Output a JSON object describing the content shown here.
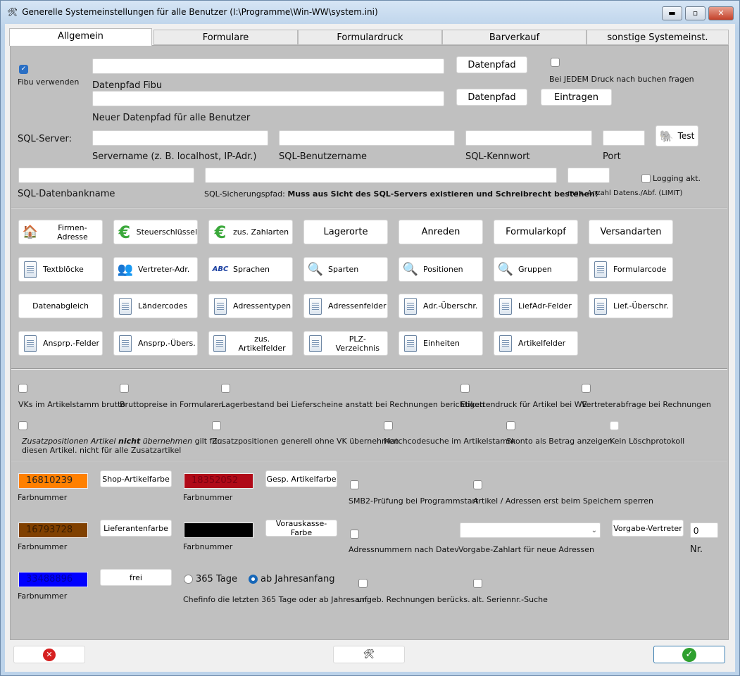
{
  "window": {
    "title": "Generelle Systemeinstellungen für alle Benutzer (I:\\Programme\\Win-WW\\system.ini)",
    "minimize": "▬",
    "maximize": "▫",
    "close": "✕"
  },
  "tabs": [
    "Allgemein",
    "Formulare",
    "Formulardruck",
    "Barverkauf",
    "sonstige Systemeinst."
  ],
  "fibu": {
    "use_label": "Fibu verwenden",
    "use_checked": true,
    "path_value": "",
    "path_label": "Datenpfad Fibu",
    "datenpfad_btn": "Datenpfad",
    "new_path_value": "",
    "new_path_label": "Neuer Datenpfad für alle Benutzer",
    "datenpfad_btn2": "Datenpfad",
    "eintragen_btn": "Eintragen",
    "jedem_label": "Bei JEDEM Druck nach buchen fragen"
  },
  "sql": {
    "server_label": "SQL-Server:",
    "servername_label": "Servername (z. B. localhost, IP-Adr.)",
    "user_label": "SQL-Benutzername",
    "password_label": "SQL-Kennwort",
    "port_label": "Port",
    "test_btn": "Test",
    "dbname_label": "SQL-Datenbankname",
    "backup_prefix": "SQL-Sicherungspfad: ",
    "backup_bold": "Muss aus Sicht des SQL-Servers existieren und Schreibrecht bestehen!",
    "limit_label": "max. Anzahl Datens./Abf. (LIMIT)",
    "logging_label": "Logging akt."
  },
  "grid": [
    [
      {
        "label": "Firmen-Adresse",
        "icon": "house"
      },
      {
        "label": "Steuerschlüssel",
        "icon": "euro"
      },
      {
        "label": "zus. Zahlarten",
        "icon": "euro"
      },
      {
        "label": "Lagerorte",
        "icon": ""
      },
      {
        "label": "Anreden",
        "icon": ""
      },
      {
        "label": "Formularkopf",
        "icon": ""
      },
      {
        "label": "Versandarten",
        "icon": ""
      }
    ],
    [
      {
        "label": "Textblöcke",
        "icon": "doc"
      },
      {
        "label": "Vertreter-Adr.",
        "icon": "people"
      },
      {
        "label": "Sprachen",
        "icon": "abc"
      },
      {
        "label": "Sparten",
        "icon": "search"
      },
      {
        "label": "Positionen",
        "icon": "search"
      },
      {
        "label": "Gruppen",
        "icon": "search"
      },
      {
        "label": "Formularcode",
        "icon": "doc"
      }
    ],
    [
      {
        "label": "Datenabgleich",
        "icon": ""
      },
      {
        "label": "Ländercodes",
        "icon": "doc"
      },
      {
        "label": "Adressentypen",
        "icon": "doc"
      },
      {
        "label": "Adressenfelder",
        "icon": "doc"
      },
      {
        "label": "Adr.-Überschr.",
        "icon": "doc"
      },
      {
        "label": "LiefAdr-Felder",
        "icon": "doc"
      },
      {
        "label": "Lief.-Überschr.",
        "icon": "doc"
      }
    ],
    [
      {
        "label": "Ansprp.-Felder",
        "icon": "doc"
      },
      {
        "label": "Ansprp.-Übers.",
        "icon": "doc"
      },
      {
        "label": "zus. Artikelfelder",
        "icon": "doc"
      },
      {
        "label": "PLZ-Verzeichnis",
        "icon": "doc"
      },
      {
        "label": "Einheiten",
        "icon": "doc"
      },
      {
        "label": "Artikelfelder",
        "icon": "doc"
      }
    ]
  ],
  "options": {
    "vk_brutto": "VKs im Artikelstamm brutto",
    "bruttopreise": "Bruttopreise in Formularen",
    "lagerbestand": "Lagerbestand bei Lieferscheine anstatt bei Rechnungen berichtigen",
    "etikettendruck": "Etikettendruck für Artikel bei WE",
    "vertreterabfrage": "Vertreterabfrage bei Rechnungen",
    "zusatz_it1": "Zusatzpositionen Artikel ",
    "zusatz_bold": "nicht",
    "zusatz_it2": " übernehmen",
    "zusatz_rest": " gilt für",
    "zusatz_line2": "diesen Artikel. nicht für alle Zusatzartikel",
    "zusatz_ohne_vk": "Zusatzpositionen generell ohne VK übernehmen",
    "matchcode": "Matchcodesuche im Artikelstamm",
    "skonto": "Skonto als Betrag anzeigen",
    "loeschprotokoll": "Kein Löschprotokoll"
  },
  "colors": {
    "farbnummer": "Farbnummer",
    "shop": {
      "value": "16810239",
      "color": "#ff8000",
      "text": "#222",
      "btn": "Shop-Artikelfarbe"
    },
    "gesp": {
      "value": "18352052",
      "color": "#b00a18",
      "text": "#7a0010",
      "btn": "Gesp. Artikelfarbe"
    },
    "liefer": {
      "value": "16793728",
      "color": "#804000",
      "text": "#3a1c00",
      "btn": "Lieferantenfarbe"
    },
    "vorkasse": {
      "value": "",
      "color": "#000000",
      "text": "#000",
      "btn": "Vorauskasse-Farbe"
    },
    "frei": {
      "value": "33488896",
      "color": "#0000ff",
      "text": "#0000a0",
      "btn": "frei"
    }
  },
  "misc": {
    "smb2": "SMB2-Prüfung bei Programmstart",
    "sperren": "Artikel / Adressen erst beim Speichern sperren",
    "datev": "Adressnummern nach Datev",
    "zahlart_label": "Vorgabe-Zahlart für neue Adressen",
    "zahlart_value": "",
    "vertreter_btn": "Vorgabe-Vertreter",
    "vertreter_nr": "0",
    "nr_label": "Nr.",
    "radio_365": "365 Tage",
    "radio_jahr": "ab Jahresanfang",
    "chefinfo": "Chefinfo die letzten 365 Tage oder ab Jahresanf.",
    "ungeb": "ungeb. Rechnungen berücks.",
    "seriennr": "alt. Seriennr.-Suche"
  }
}
